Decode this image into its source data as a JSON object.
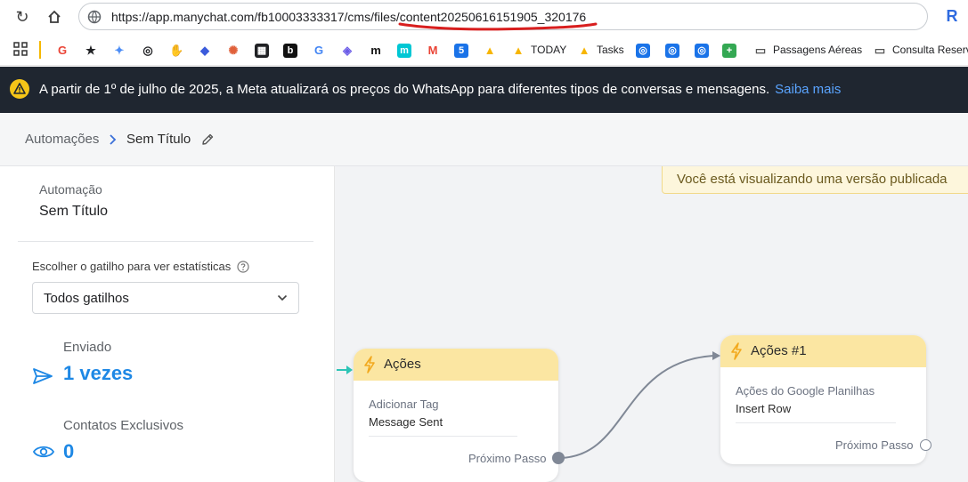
{
  "browser": {
    "url_host": "https://app.manychat.com",
    "url_path": "/fb10003333317/cms/files/content20250616151905_320176",
    "bookmarks": [
      {
        "label": "",
        "icon": "google-icon",
        "color": "#ea4335"
      },
      {
        "label": "",
        "icon": "star-icon",
        "color": "#202124"
      },
      {
        "label": "",
        "icon": "gemini-icon",
        "color": "#4c8df6"
      },
      {
        "label": "",
        "icon": "openai-icon",
        "color": "#202124"
      },
      {
        "label": "",
        "icon": "hand-icon",
        "color": "#444"
      },
      {
        "label": "",
        "icon": "bird-icon",
        "color": "#3b5bdb"
      },
      {
        "label": "",
        "icon": "sunburst-icon",
        "color": "#e0603a"
      },
      {
        "label": "",
        "icon": "grid-app-icon",
        "color": "#202124"
      },
      {
        "label": "",
        "icon": "b-app-icon",
        "color": "#111"
      },
      {
        "label": "",
        "icon": "google-icon",
        "color": "#4285f4"
      },
      {
        "label": "",
        "icon": "layers-icon",
        "color": "#6b5ce7"
      },
      {
        "label": "",
        "icon": "m-app-icon",
        "color": "#111"
      },
      {
        "label": "",
        "icon": "miro-icon",
        "color": "#00c7d4"
      },
      {
        "label": "",
        "icon": "gmail-icon",
        "color": "#ea4335"
      },
      {
        "label": "",
        "icon": "calendar-icon",
        "color": "#1a73e8"
      },
      {
        "label": "",
        "icon": "airtable-icon",
        "color": "#f7b500"
      },
      {
        "label": "TODAY",
        "icon": "airtable-icon",
        "color": "#f7b500"
      },
      {
        "label": "Tasks",
        "icon": "airtable-icon",
        "color": "#f7b500"
      },
      {
        "label": "",
        "icon": "openai-icon",
        "color": "#1a73e8"
      },
      {
        "label": "",
        "icon": "openai-icon",
        "color": "#1a73e8"
      },
      {
        "label": "",
        "icon": "openai-icon",
        "color": "#1a73e8"
      },
      {
        "label": "",
        "icon": "sheets-icon",
        "color": "#34a853"
      },
      {
        "label": "Passagens Aéreas",
        "icon": "folder-icon",
        "color": "#555"
      },
      {
        "label": "Consulta Reserv",
        "icon": "folder-icon",
        "color": "#555"
      }
    ]
  },
  "banner": {
    "text": "A partir de 1º de julho de 2025, a Meta atualizará os preços do WhatsApp para diferentes tipos de conversas e mensagens.",
    "link": "Saiba mais"
  },
  "breadcrumb": {
    "root": "Automações",
    "current": "Sem Título"
  },
  "sidebar": {
    "section_label": "Automação",
    "automation_name": "Sem Título",
    "trigger_label": "Escolher o gatilho para ver estatísticas",
    "trigger_value": "Todos gatilhos",
    "sent_label": "Enviado",
    "sent_value": "1 vezes",
    "contacts_label": "Contatos Exclusivos",
    "contacts_value": "0"
  },
  "canvas": {
    "notice": "Você está visualizando uma versão publicada",
    "node1": {
      "title": "Ações",
      "action_label": "Adicionar Tag",
      "action_value": "Message Sent",
      "next": "Próximo Passo"
    },
    "node2": {
      "title": "Ações #1",
      "action_label": "Ações do Google Planilhas",
      "action_value": "Insert Row",
      "next": "Próximo Passo"
    }
  },
  "colors": {
    "accent": "#1e88e5",
    "node_header": "#fbe6a2",
    "bolt": "#f2a91e",
    "banner_bg": "#1f2630",
    "link": "#5aa4ff",
    "connector_in": "#2ec4b6"
  }
}
